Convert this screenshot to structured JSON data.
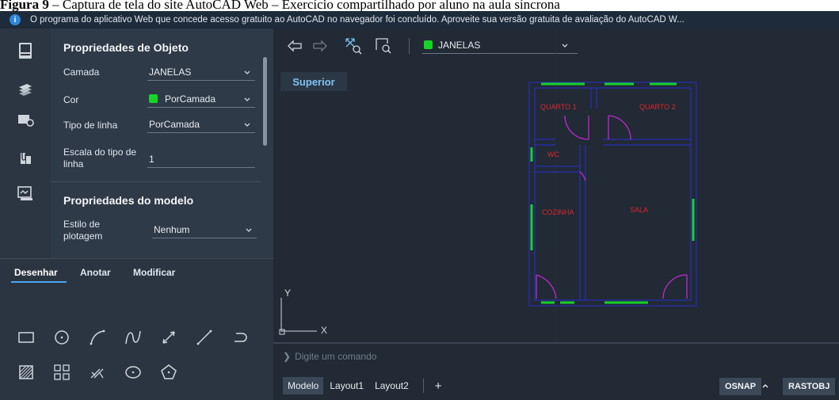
{
  "caption": {
    "bold": "Figura 9",
    "rest": " – Captura de tela do site AutoCAD Web – Exercício compartilhado por aluno na aula síncrona"
  },
  "banner": {
    "icon": "info-icon",
    "text": "O programa do aplicativo Web que concede acesso gratuito ao AutoCAD no navegador foi concluído. Aproveite sua versão gratuita de avaliação do AutoCAD W..."
  },
  "sidebar_icons": [
    "properties-panel-icon",
    "layers-icon",
    "blocks-icon",
    "attach-icon",
    "xref-icon"
  ],
  "properties": {
    "object_title": "Propriedades de Objeto",
    "rows": [
      {
        "label": "Camada",
        "value": "JANELAS",
        "swatch": false
      },
      {
        "label": "Cor",
        "value": "PorCamada",
        "swatch": true
      },
      {
        "label": "Tipo de linha",
        "value": "PorCamada",
        "swatch": false
      },
      {
        "label": "Escala do tipo de linha",
        "value": "1",
        "swatch": false
      }
    ],
    "model_title": "Propriedades do modelo",
    "model_rows": [
      {
        "label": "Estilo de plotagem",
        "value": "Nenhum"
      }
    ],
    "swatch_color": "#14d424"
  },
  "tools": {
    "tabs": [
      "Desenhar",
      "Anotar",
      "Modificar"
    ],
    "active_tab": "Desenhar",
    "icons": [
      "rectangle-icon",
      "circle-icon",
      "arc-icon",
      "spline-icon",
      "measure-icon",
      "line-icon",
      "polyline-icon",
      "hatch-icon",
      "array-icon",
      "trim-icon",
      "ellipse-icon",
      "polygon-icon"
    ]
  },
  "toolbar": {
    "buttons": [
      "undo-icon",
      "redo-icon",
      "zoom-extents-icon",
      "zoom-window-icon"
    ],
    "layer": "JANELAS",
    "layer_color": "#14d424"
  },
  "viewport": {
    "view_label": "Superior",
    "rooms": [
      "QUARTO 1",
      "QUARTO 2",
      "WC",
      "COZINHA",
      "SALA"
    ],
    "ucs_x": "X",
    "ucs_y": "Y"
  },
  "command": {
    "placeholder": "Digite um comando"
  },
  "bottom": {
    "tabs": [
      "Modelo",
      "Layout1",
      "Layout2"
    ],
    "active_tab": "Modelo",
    "add_label": "+",
    "osnap": "OSNAP",
    "rastobj": "RASTOBJ"
  },
  "colors": {
    "wall": "#2b2fb6",
    "window": "#18d12a",
    "door": "#c328cf",
    "room_text": "#e0242c",
    "accent": "#4aa5f0"
  }
}
